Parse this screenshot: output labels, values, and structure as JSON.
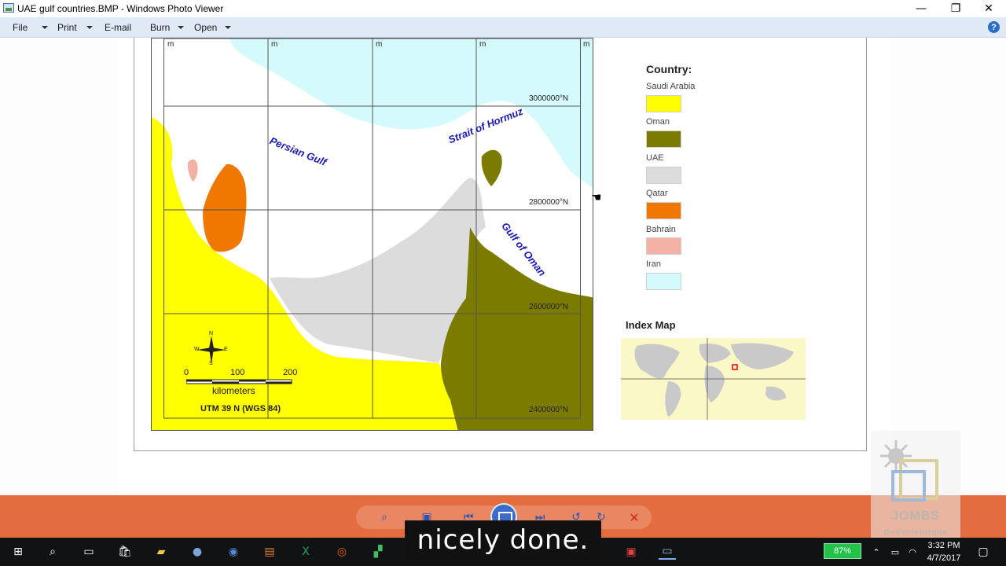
{
  "window": {
    "title": "UAE gulf countries.BMP - Windows Photo Viewer",
    "controls": {
      "minimize": "—",
      "restore": "❐",
      "close": "✕"
    }
  },
  "menu": {
    "items": [
      {
        "label": "File",
        "has_dropdown": true
      },
      {
        "label": "Print",
        "has_dropdown": true
      },
      {
        "label": "E-mail",
        "has_dropdown": false
      },
      {
        "label": "Burn",
        "has_dropdown": true
      },
      {
        "label": "Open",
        "has_dropdown": true
      }
    ],
    "help": "?"
  },
  "map": {
    "grid_labels": [
      "3000000°N",
      "2800000°N",
      "2600000°N",
      "2400000°N"
    ],
    "top_tick_label": "m",
    "water_labels": {
      "persian_gulf": "Persian Gulf",
      "strait": "Strait of Hormuz",
      "gulf_oman": "Gulf of Oman"
    },
    "scale": {
      "ticks": [
        "0",
        "100",
        "200"
      ],
      "unit": "kilometers"
    },
    "compass": {
      "n": "N",
      "s": "S",
      "e": "E",
      "w": "W"
    },
    "projection": "UTM 39 N (WGS 84)"
  },
  "legend": {
    "title": "Country:",
    "items": [
      {
        "name": "Saudi Arabia",
        "color": "#ffff00"
      },
      {
        "name": "Oman",
        "color": "#7b7b00"
      },
      {
        "name": "UAE",
        "color": "#dcdcdc"
      },
      {
        "name": "Qatar",
        "color": "#f07800"
      },
      {
        "name": "Bahrain",
        "color": "#f3b1a4"
      },
      {
        "name": "Iran",
        "color": "#d4fafc"
      }
    ],
    "index_map_title": "Index Map"
  },
  "caption": "nicely done.",
  "taskbar": {
    "battery": "87%",
    "time": "3:32 PM",
    "date": "4/7/2017"
  },
  "watermark": {
    "brand": "JOMBS",
    "tagline": "Geoscientique"
  },
  "colors": {
    "menubar": "#dfeaf6",
    "orange_strip": "#e36d3f",
    "water_label": "#1a1ab0",
    "iran": "#d4fafc"
  }
}
